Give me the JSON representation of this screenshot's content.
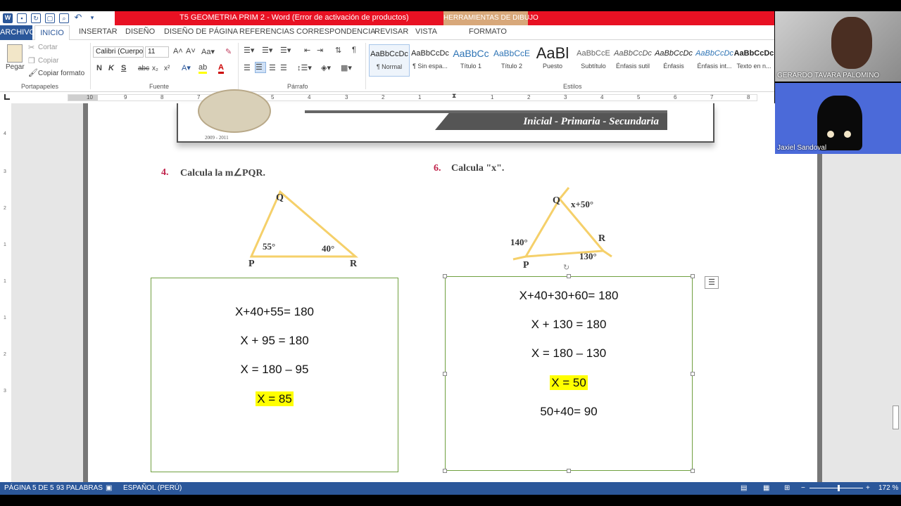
{
  "titlebar": {
    "doc_title": "T5 GEOMETRIA PRIM 2 -  Word (Error de activación de productos)",
    "context_tool_header": "HERRAMIENTAS DE DIBUJO"
  },
  "tabs": {
    "archivo": "ARCHIVO",
    "inicio": "INICIO",
    "insertar": "INSERTAR",
    "diseno": "DISEÑO",
    "diseno_pagina": "DISEÑO DE PÁGINA",
    "referencias": "REFERENCIAS",
    "correspondencia": "CORRESPONDENCIA",
    "revisar": "REVISAR",
    "vista": "VISTA",
    "formato": "FORMATO"
  },
  "ribbon": {
    "clipboard": {
      "paste": "Pegar",
      "cut": "Cortar",
      "copy": "Copiar",
      "format_painter": "Copiar formato",
      "label": "Portapapeles"
    },
    "font": {
      "family": "Calibri (Cuerpo",
      "size": "11",
      "label": "Fuente",
      "bold": "N",
      "italic": "K",
      "underline": "S",
      "strike": "abc",
      "sub": "x₂",
      "sup": "x²"
    },
    "paragraph": {
      "label": "Párrafo"
    },
    "styles": {
      "label": "Estilos",
      "items": [
        {
          "preview": "AaBbCcDc",
          "name": "¶ Normal"
        },
        {
          "preview": "AaBbCcDc",
          "name": "¶ Sin espa..."
        },
        {
          "preview": "AaBbCc",
          "name": "Título 1"
        },
        {
          "preview": "AaBbCcE",
          "name": "Título 2"
        },
        {
          "preview": "AaBl",
          "name": "Puesto"
        },
        {
          "preview": "AaBbCcE",
          "name": "Subtítulo"
        },
        {
          "preview": "AaBbCcDc",
          "name": "Énfasis sutil"
        },
        {
          "preview": "AaBbCcDc",
          "name": "Énfasis"
        },
        {
          "preview": "AaBbCcDc",
          "name": "Énfasis int..."
        },
        {
          "preview": "AaBbCcDc",
          "name": "Texto en n..."
        }
      ]
    }
  },
  "ruler": {
    "ticks": [
      "10",
      "9",
      "8",
      "7",
      "6",
      "5",
      "4",
      "3",
      "2",
      "1",
      "1",
      "2",
      "3",
      "4",
      "5",
      "6",
      "7",
      "8"
    ]
  },
  "vruler": {
    "ticks": [
      "4",
      "3",
      "2",
      "1",
      "1",
      "1",
      "2",
      "3"
    ]
  },
  "document": {
    "banner_text": "Inicial - Primaria - Secundaria",
    "seal_year": "2009 - 2011",
    "q4": {
      "number": "4.",
      "text": "Calcula la m∠PQR.",
      "labels": {
        "Q": "Q",
        "P": "P",
        "R": "R",
        "angle_p": "55°",
        "angle_r": "40°"
      },
      "answer": [
        "X+40+55= 180",
        "X + 95 = 180",
        "X = 180 – 95",
        "X = 85"
      ]
    },
    "q6": {
      "number": "6.",
      "text": "Calcula \"x\".",
      "labels": {
        "Q": "Q",
        "P": "P",
        "R": "R",
        "angle_q": "x+50°",
        "angle_p": "140°",
        "angle_r": "130°"
      },
      "answer": [
        "X+40+30+60= 180",
        "X + 130 = 180",
        "X = 180 – 130",
        "X = 50",
        "50+40= 90"
      ]
    }
  },
  "statusbar": {
    "page": "PÁGINA 5 DE 5",
    "words": "93 PALABRAS",
    "language": "ESPAÑOL (PERÚ)",
    "zoom": "172 %"
  },
  "video": {
    "participant1": "GERARDO TAVARA PALOMINO",
    "participant2": "Jaxiel Sandoval"
  },
  "colors": {
    "word_blue": "#2b579a",
    "title_red": "#e81123",
    "highlight": "#ffff00",
    "box_border": "#70a040",
    "triangle": "#f5d06a",
    "question_number": "#c0234b"
  }
}
